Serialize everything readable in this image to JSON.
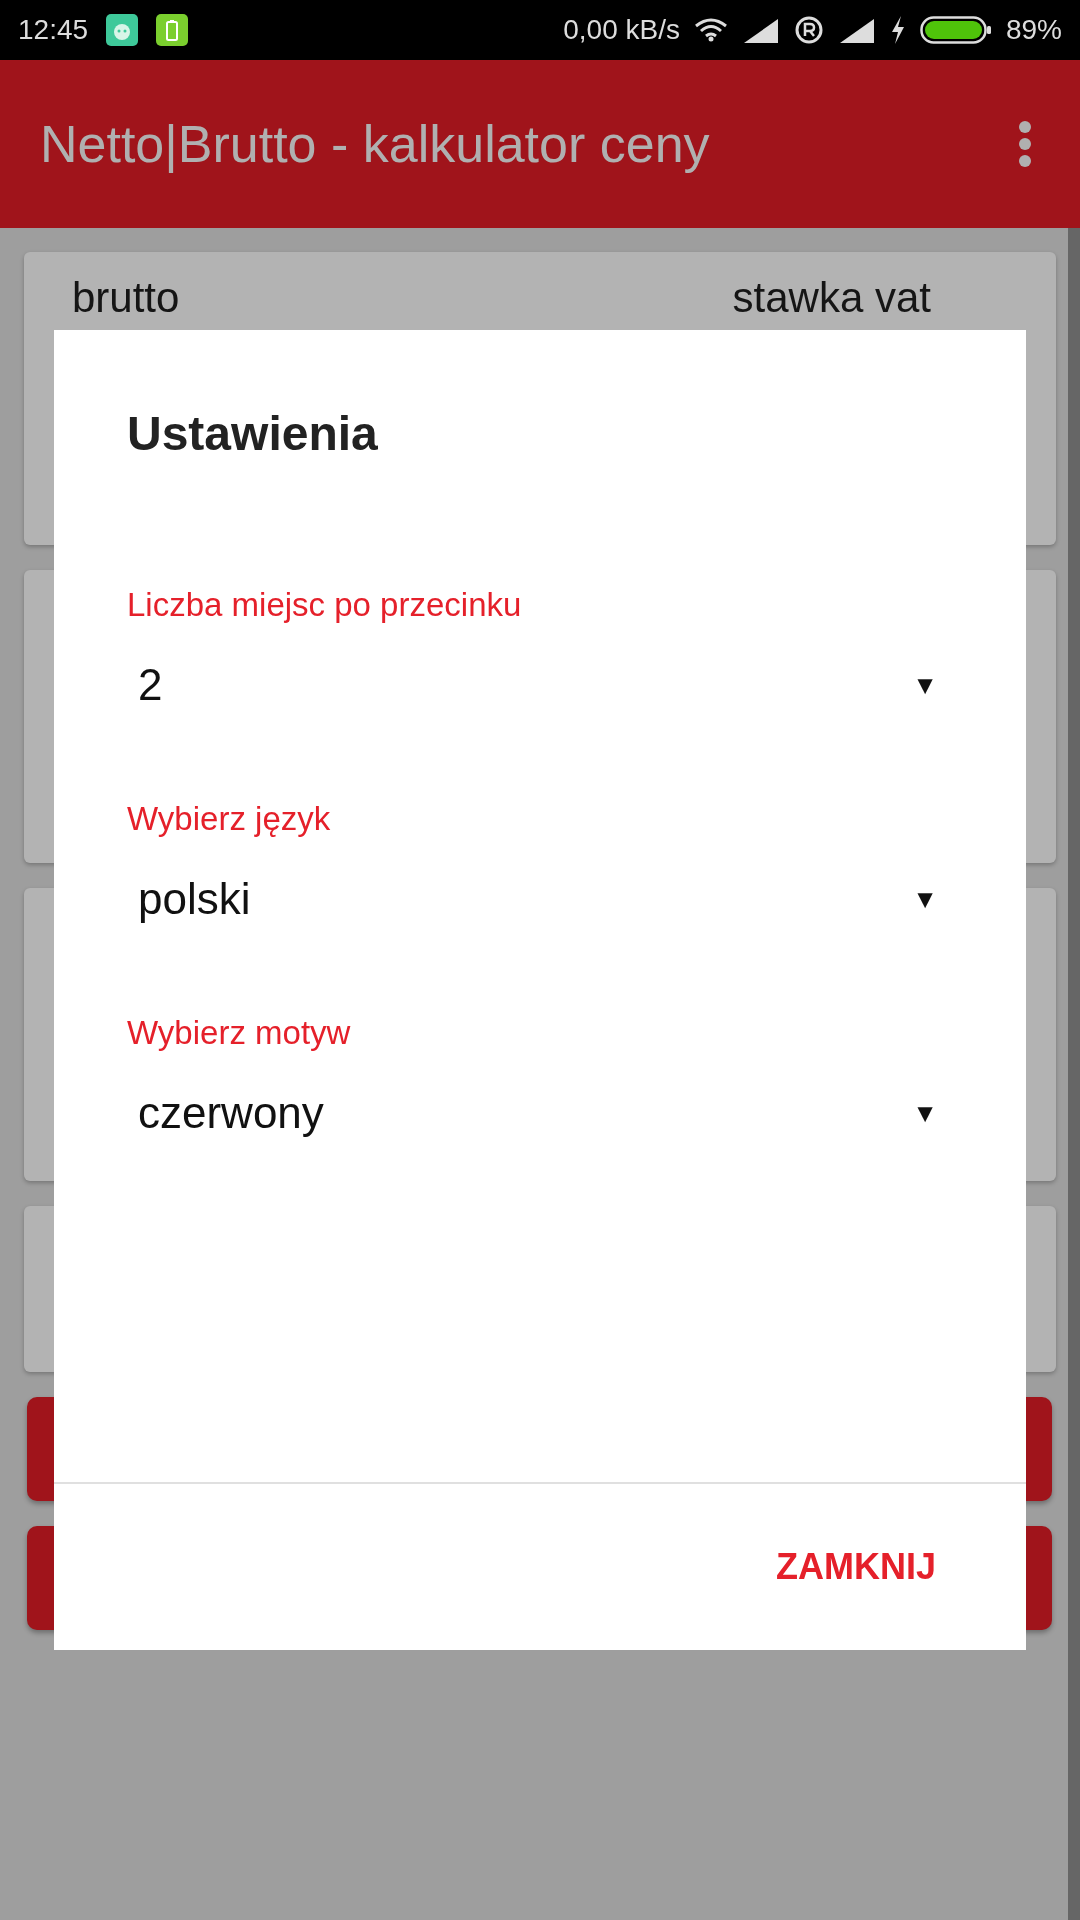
{
  "status_bar": {
    "time": "12:45",
    "network_speed": "0,00 kB/s",
    "battery": "89%"
  },
  "app_bar": {
    "title": "Netto|Brutto - kalkulator ceny"
  },
  "background": {
    "card_labels": [
      "brutto",
      "stawka vat"
    ]
  },
  "dialog": {
    "title": "Ustawienia",
    "fields": [
      {
        "label": "Liczba miejsc po przecinku",
        "value": "2"
      },
      {
        "label": "Wybierz język",
        "value": "polski"
      },
      {
        "label": "Wybierz motyw",
        "value": "czerwony"
      }
    ],
    "arrow": "▼",
    "button": "ZAMKNIJ"
  }
}
